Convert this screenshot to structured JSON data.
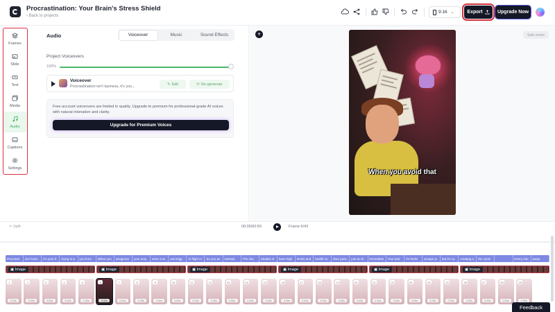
{
  "header": {
    "title": "Procrastination: Your Brain's Stress Shield",
    "back_link": "Back to projects",
    "aspect_ratio": "9:16",
    "export_label": "Export",
    "upgrade_label": "Upgrade Now"
  },
  "sidebar": {
    "items": [
      {
        "label": "Frames",
        "icon": "layers-icon"
      },
      {
        "label": "Slide",
        "icon": "slide-icon"
      },
      {
        "label": "Text",
        "icon": "text-icon"
      },
      {
        "label": "Media",
        "icon": "media-icon"
      },
      {
        "label": "Audio",
        "icon": "music-note-icon",
        "active": true
      },
      {
        "label": "Captions",
        "icon": "captions-icon"
      },
      {
        "label": "Settings",
        "icon": "gear-icon"
      }
    ]
  },
  "audio_panel": {
    "title": "Audio",
    "tabs": [
      "Voiceover",
      "Music",
      "Sound Effects"
    ],
    "active_tab": "Voiceover",
    "section_label": "Project Voiceovers",
    "volume_percent": "100%",
    "volume_value": 1.0,
    "voiceover": {
      "name": "Voiceover",
      "text": "Procrastination isn't laziness, it's you...",
      "edit_label": "Edit",
      "regenerate_label": "Re-generate"
    },
    "notice": {
      "text": "Free account voiceovers are limited in quality. Upgrade to premium for professional-grade AI voices with natural intonation and clarity.",
      "button_label": "Upgrade for Premium Voices"
    }
  },
  "preview": {
    "safe_zones_label": "Safe zones",
    "caption_text": "When you avoid that"
  },
  "playback": {
    "split_label": "Split",
    "timecode": "00:05/00:50",
    "frame_label": "Frame 6/43"
  },
  "timeline": {
    "caption_chips": [
      "Procrasti",
      "isn't lazin",
      "it's your b",
      "trying to p",
      "you from",
      "When you",
      "assignme",
      "your amy",
      "sees it as",
      "and trigg",
      "or flight m",
      "So you av",
      "instead.",
      "The intu",
      "Studies sl",
      "have high",
      "levels and",
      "health ou",
      "then pass",
      "just do th",
      "immediate",
      "Your brai",
      "it's feelin",
      "escape ju",
      "but it's ac",
      "creating a",
      "the cycle",
      "",
      "Every min",
      "away."
    ],
    "image_clip_label": "Image",
    "image_clip_count": 6,
    "frames": [
      {
        "num": "1",
        "dur": "0.00s"
      },
      {
        "num": "2",
        "dur": "0.00s"
      },
      {
        "num": "3",
        "dur": "0.00s"
      },
      {
        "num": "4",
        "dur": "0.00s"
      },
      {
        "num": "5",
        "dur": "0.00s"
      },
      {
        "num": "6",
        "dur": "0.00s",
        "selected": true
      },
      {
        "num": "7",
        "dur": "0.00s"
      },
      {
        "num": "8",
        "dur": "0.00s"
      },
      {
        "num": "9",
        "dur": "0.00s"
      },
      {
        "num": "10",
        "dur": "0.00s"
      },
      {
        "num": "11",
        "dur": "0.00s"
      },
      {
        "num": "12",
        "dur": "0.00s"
      },
      {
        "num": "13",
        "dur": "0.00s"
      },
      {
        "num": "14",
        "dur": "0.00s"
      },
      {
        "num": "15",
        "dur": "0.00s"
      },
      {
        "num": "16",
        "dur": "0.00s"
      },
      {
        "num": "17",
        "dur": "0.00s"
      },
      {
        "num": "18",
        "dur": "0.00s"
      },
      {
        "num": "19",
        "dur": "0.00s"
      },
      {
        "num": "20",
        "dur": "0.00s"
      },
      {
        "num": "21",
        "dur": "0.00s"
      },
      {
        "num": "22",
        "dur": "0.00s"
      },
      {
        "num": "23",
        "dur": "0.00s"
      },
      {
        "num": "24",
        "dur": "0.00s"
      },
      {
        "num": "25",
        "dur": "0.00s"
      },
      {
        "num": "26",
        "dur": "0.00s"
      },
      {
        "num": "27",
        "dur": "0.00s"
      },
      {
        "num": "28",
        "dur": "0.00s"
      },
      {
        "num": "29",
        "dur": "0.00s"
      }
    ]
  },
  "feedback_label": "Feedback",
  "colors": {
    "accent": "#151826",
    "highlight": "#d5303f",
    "active_green": "#3fae5a",
    "caption_track": "#7d89e3"
  }
}
